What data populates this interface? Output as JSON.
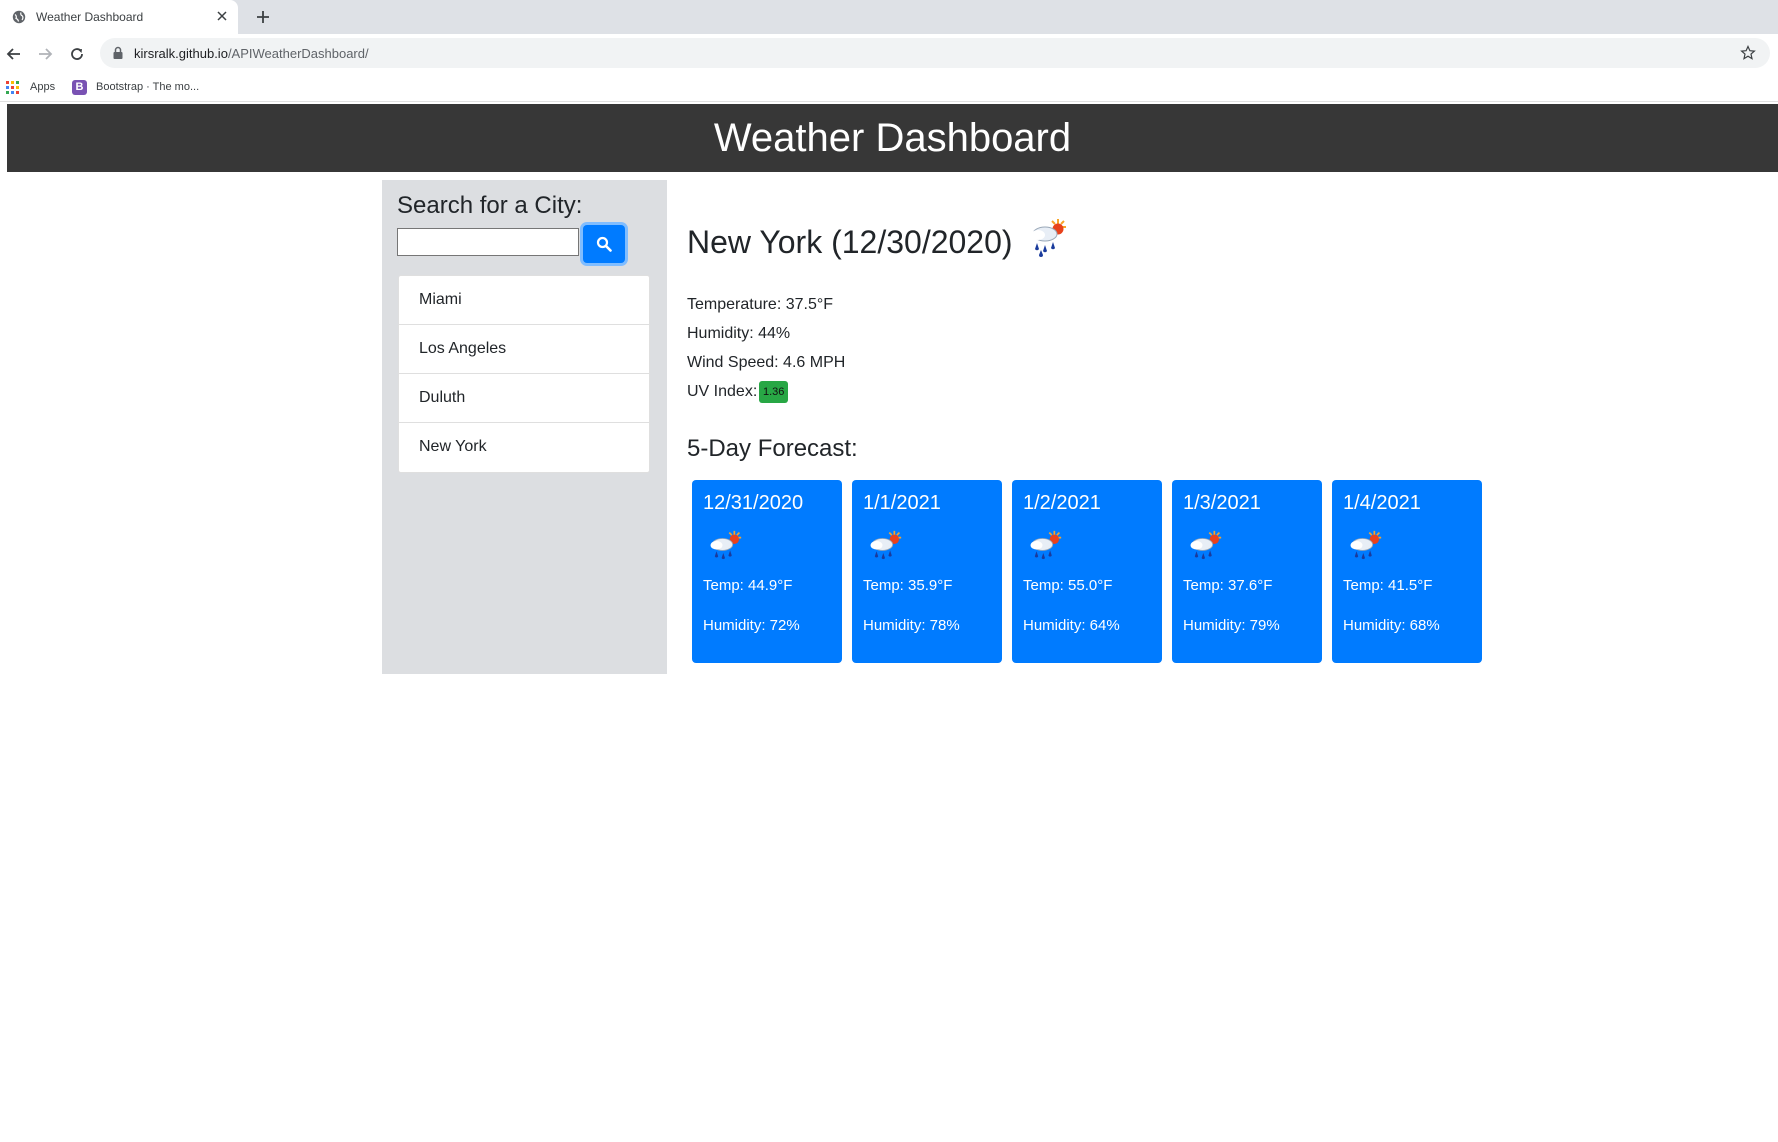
{
  "browser": {
    "tab_title": "Weather Dashboard",
    "url_host": "kirsralk.github.io",
    "url_path": "/APIWeatherDashboard/",
    "bookmarks": [
      {
        "label": "Apps",
        "icon": "apps-grid-icon"
      },
      {
        "label": "Bootstrap · The mo...",
        "icon": "bootstrap-icon"
      }
    ]
  },
  "header": {
    "title": "Weather Dashboard"
  },
  "sidebar": {
    "search_title": "Search for a City:",
    "search_value": "",
    "search_button_icon": "search-icon",
    "cities": [
      {
        "name": "Miami"
      },
      {
        "name": "Los Angeles"
      },
      {
        "name": "Duluth"
      },
      {
        "name": "New York"
      }
    ]
  },
  "current": {
    "heading": "New York (12/30/2020)",
    "icon": "rain-sun-icon",
    "temperature": "Temperature: 37.5°F",
    "humidity": "Humidity: 44%",
    "wind": "Wind Speed: 4.6 MPH",
    "uv_label": "UV Index:",
    "uv_value": "1.36",
    "uv_color": "#28a745"
  },
  "forecast": {
    "title": "5-Day Forecast:",
    "card_color": "#007bff",
    "days": [
      {
        "date": "12/31/2020",
        "temp": "Temp: 44.9°F",
        "humidity": "Humidity: 72%",
        "icon": "rain-sun-icon"
      },
      {
        "date": "1/1/2021",
        "temp": "Temp: 35.9°F",
        "humidity": "Humidity: 78%",
        "icon": "rain-sun-icon"
      },
      {
        "date": "1/2/2021",
        "temp": "Temp: 55.0°F",
        "humidity": "Humidity: 64%",
        "icon": "rain-sun-icon"
      },
      {
        "date": "1/3/2021",
        "temp": "Temp: 37.6°F",
        "humidity": "Humidity: 79%",
        "icon": "rain-sun-icon"
      },
      {
        "date": "1/4/2021",
        "temp": "Temp: 41.5°F",
        "humidity": "Humidity: 68%",
        "icon": "rain-sun-icon"
      }
    ]
  }
}
